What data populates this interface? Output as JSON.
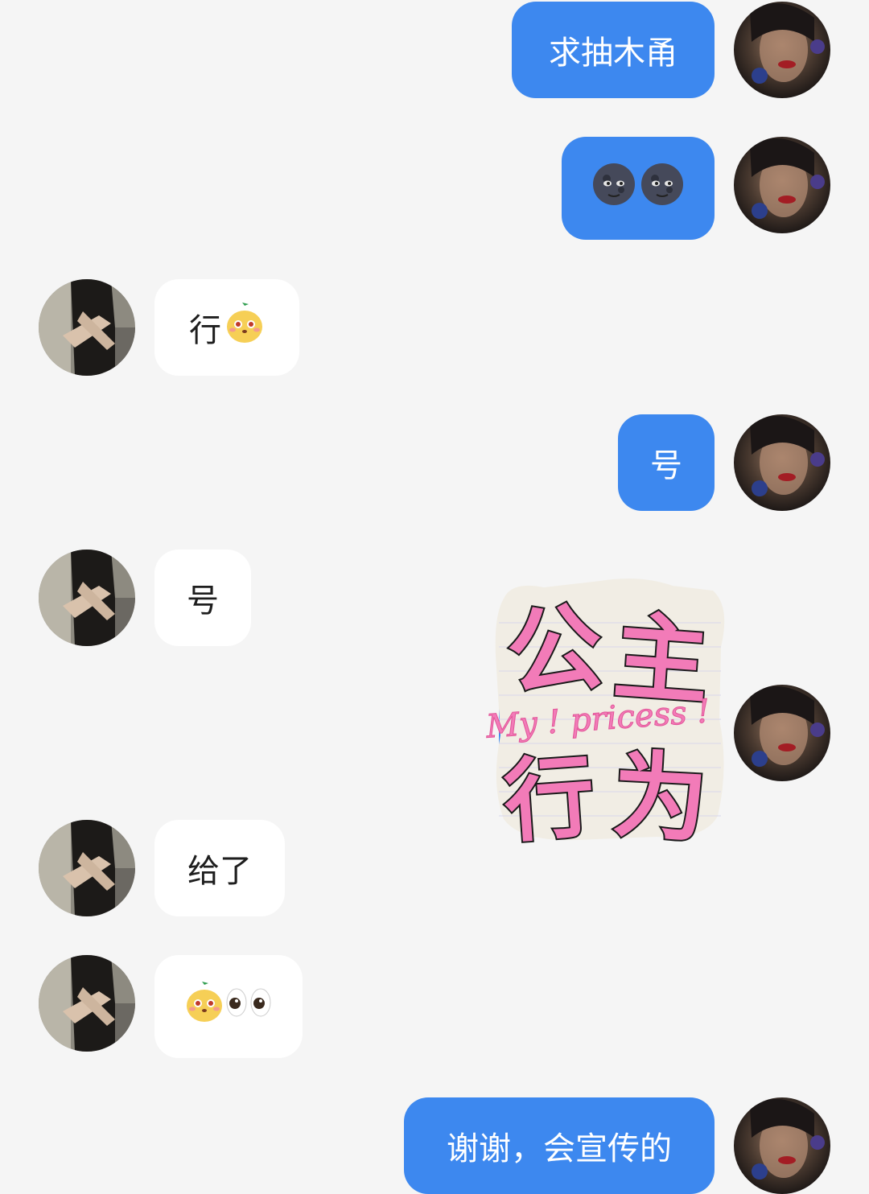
{
  "conversation": {
    "messages": [
      {
        "side": "me",
        "type": "text",
        "text": "求抽木甬"
      },
      {
        "side": "me",
        "type": "emoji",
        "emojis": [
          "new-moon-face-emoji",
          "new-moon-face-emoji"
        ]
      },
      {
        "side": "them",
        "type": "text",
        "text": "行",
        "emojis": [
          "yellow-blob-sticker-emoji"
        ]
      },
      {
        "side": "me",
        "type": "text",
        "text": "号"
      },
      {
        "side": "them",
        "type": "text",
        "text": "号"
      },
      {
        "side": "me",
        "type": "sticker",
        "sticker_name": "princess-sticker",
        "sticker_text": [
          "公",
          "主",
          "My ! pricess !",
          "行",
          "为"
        ]
      },
      {
        "side": "them",
        "type": "text",
        "text": "给了"
      },
      {
        "side": "them",
        "type": "emoji",
        "emojis": [
          "yellow-blob-sticker-emoji",
          "eyes-emoji"
        ]
      },
      {
        "side": "me",
        "type": "text",
        "text": "谢谢，会宣传的"
      }
    ]
  },
  "colors": {
    "outgoing_bubble": "#3d88ef",
    "incoming_bubble": "#ffffff",
    "background": "#f5f5f5",
    "sticker_pink": "#f27bb8"
  }
}
